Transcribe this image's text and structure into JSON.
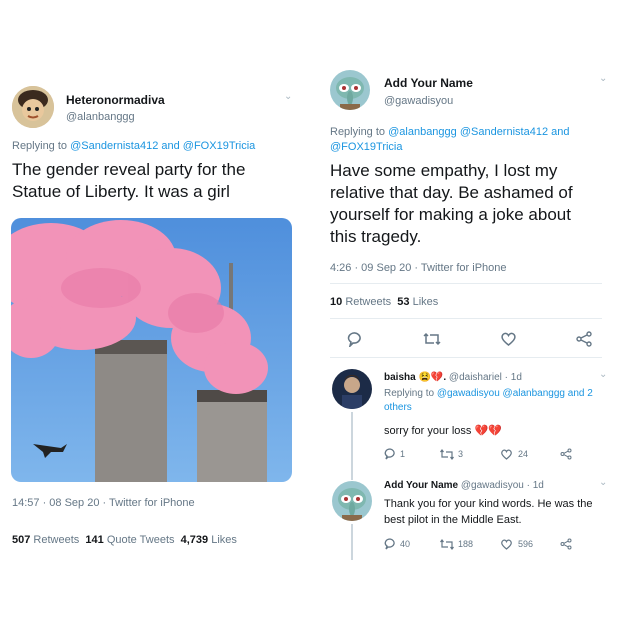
{
  "left": {
    "name": "Heteronormadiva",
    "handle": "@alanbanggg",
    "replying_prefix": "Replying to",
    "replying_to": "@Sandernista412 and @FOX19Tricia",
    "text": "The gender reveal party for the Statue of Liberty. It was a girl",
    "meta": "14:57 · 08 Sep 20 · Twitter for iPhone",
    "stats": {
      "retweets": "507",
      "retweets_label": "Retweets",
      "quotes": "141",
      "quotes_label": "Quote Tweets",
      "likes": "4,739",
      "likes_label": "Likes"
    }
  },
  "right": {
    "name": "Add Your Name",
    "handle": "@gawadisyou",
    "replying_prefix": "Replying to",
    "replying_to": "@alanbanggg @Sandernista412 and @FOX19Tricia",
    "text": "Have some empathy, I lost my relative that day.  Be ashamed of yourself for making a joke about this tragedy.",
    "meta": "4:26 · 09 Sep 20 · Twitter for iPhone",
    "stats": {
      "retweets": "10",
      "retweets_label": "Retweets",
      "likes": "53",
      "likes_label": "Likes"
    }
  },
  "reply1": {
    "name": "baisha 😫💔.",
    "handle": "@daishariel · 1d",
    "replying_prefix": "Replying to",
    "replying_to": "@gawadisyou @alanbanggg and 2 others",
    "text": "sorry for your loss 💔💔",
    "replies": "1",
    "retweets": "3",
    "likes": "24"
  },
  "reply2": {
    "name": "Add Your Name",
    "handle": "@gawadisyou · 1d",
    "text": "Thank you for your kind words. He was the best pilot in the Middle East.",
    "replies": "40",
    "retweets": "188",
    "likes": "596"
  },
  "colors": {
    "link": "#1b95e0",
    "muted": "#657786",
    "smoke": "#f08fb4",
    "sky": "#5b9be0"
  },
  "icons": [
    "reply-icon",
    "retweet-icon",
    "like-icon",
    "share-icon",
    "chevron-down-icon"
  ]
}
